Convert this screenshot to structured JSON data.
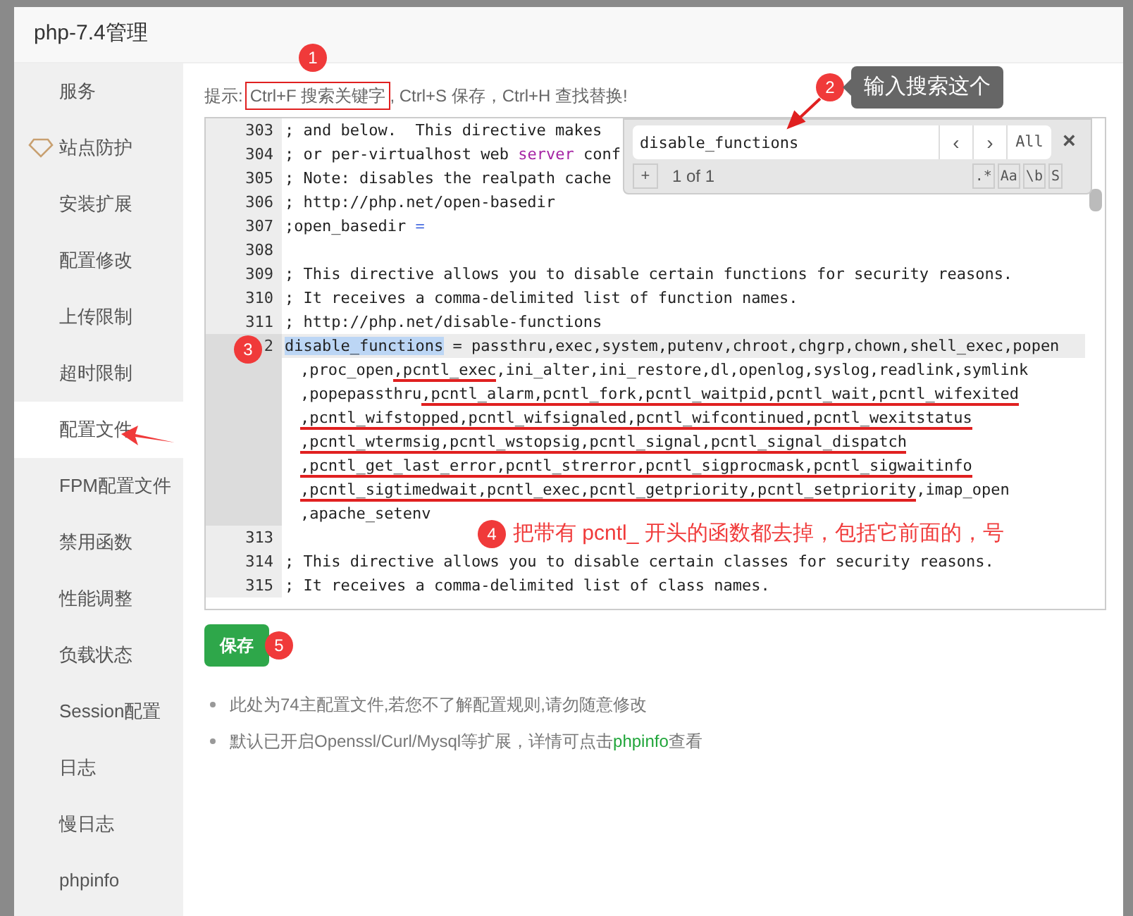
{
  "window": {
    "title": "php-7.4管理"
  },
  "sidebar": {
    "items": [
      {
        "label": "服务",
        "selected": false,
        "kind": "plain"
      },
      {
        "label": "站点防护",
        "selected": false,
        "kind": "gem"
      },
      {
        "label": "安装扩展",
        "selected": false,
        "kind": "plain"
      },
      {
        "label": "配置修改",
        "selected": false,
        "kind": "plain"
      },
      {
        "label": "上传限制",
        "selected": false,
        "kind": "plain"
      },
      {
        "label": "超时限制",
        "selected": false,
        "kind": "plain"
      },
      {
        "label": "配置文件",
        "selected": true,
        "kind": "plain"
      },
      {
        "label": "FPM配置文件",
        "selected": false,
        "kind": "plain"
      },
      {
        "label": "禁用函数",
        "selected": false,
        "kind": "plain"
      },
      {
        "label": "性能调整",
        "selected": false,
        "kind": "plain"
      },
      {
        "label": "负载状态",
        "selected": false,
        "kind": "plain"
      },
      {
        "label": "Session配置",
        "selected": false,
        "kind": "plain"
      },
      {
        "label": "日志",
        "selected": false,
        "kind": "plain"
      },
      {
        "label": "慢日志",
        "selected": false,
        "kind": "plain"
      },
      {
        "label": "phpinfo",
        "selected": false,
        "kind": "plain"
      }
    ]
  },
  "hint": {
    "label": "提示:",
    "boxed": "Ctrl+F 搜索关键字",
    "rest": ", Ctrl+S 保存，Ctrl+H 查找替换!"
  },
  "editor": {
    "lines": [
      {
        "number": "303",
        "rows": [
          [
            {
              "text": "; and below.  This directive makes"
            }
          ]
        ]
      },
      {
        "number": "304",
        "rows": [
          [
            {
              "text": "; or per-virtualhost web "
            },
            {
              "text": "server",
              "kind": "keyword"
            },
            {
              "text": " conf"
            }
          ]
        ]
      },
      {
        "number": "305",
        "rows": [
          [
            {
              "text": "; Note: disables the realpath cache"
            }
          ]
        ]
      },
      {
        "number": "306",
        "rows": [
          [
            {
              "text": "; http://php.net/open-basedir"
            }
          ]
        ]
      },
      {
        "number": "307",
        "rows": [
          [
            {
              "text": ";open_basedir "
            },
            {
              "text": "=",
              "kind": "operator"
            }
          ]
        ]
      },
      {
        "number": "308",
        "rows": [
          []
        ]
      },
      {
        "number": "309",
        "rows": [
          [
            {
              "text": "; This directive allows you to disable certain functions for security reasons."
            }
          ]
        ]
      },
      {
        "number": "310",
        "rows": [
          [
            {
              "text": "; It receives a comma-delimited list of function names."
            }
          ]
        ]
      },
      {
        "number": "311",
        "rows": [
          [
            {
              "text": "; http://php.net/disable-functions"
            }
          ]
        ]
      },
      {
        "number": "2",
        "active": true,
        "rows": [
          [
            {
              "text": "disable_functions",
              "kind": "match"
            },
            {
              "text": " = passthru,exec,system,putenv,chroot,chgrp,chown,shell_exec,popen"
            }
          ],
          [
            {
              "text": ",proc_open"
            },
            {
              "text": ",pcntl_exec",
              "underlined": true
            },
            {
              "text": ",ini_alter,ini_restore,dl,openlog,syslog,readlink,symlink"
            }
          ],
          [
            {
              "text": ",popepassthru"
            },
            {
              "text": ",pcntl_alarm,pcntl_fork,pcntl_waitpid,pcntl_wait,pcntl_wifexited",
              "underlined": true
            }
          ],
          [
            {
              "text": ",pcntl_wifstopped,pcntl_wifsignaled,pcntl_wifcontinued,pcntl_wexitstatus",
              "underlined": true
            }
          ],
          [
            {
              "text": ",pcntl_wtermsig,pcntl_wstopsig,pcntl_signal,pcntl_signal_dispatch",
              "underlined": true
            }
          ],
          [
            {
              "text": ",pcntl_get_last_error,pcntl_strerror,pcntl_sigprocmask,pcntl_sigwaitinfo",
              "underlined": true
            }
          ],
          [
            {
              "text": ",pcntl_sigtimedwait,pcntl_exec,pcntl_getpriority,pcntl_setpriority",
              "underlined": true
            },
            {
              "text": ",imap_open"
            }
          ],
          [
            {
              "text": ",apache_setenv"
            }
          ]
        ]
      },
      {
        "number": "313",
        "rows": [
          []
        ]
      },
      {
        "number": "314",
        "rows": [
          [
            {
              "text": "; This directive allows you to disable certain classes for security reasons."
            }
          ]
        ]
      },
      {
        "number": "315",
        "rows": [
          [
            {
              "text": "; It receives a comma-delimited list of class names."
            }
          ]
        ]
      }
    ]
  },
  "search": {
    "value": "disable_functions",
    "prev": "‹",
    "next": "›",
    "all": "All",
    "close": "×",
    "add": "+",
    "count": "1 of 1",
    "options": [
      ".*",
      "Aa",
      "\\b",
      "S"
    ]
  },
  "save_button": {
    "label": "保存"
  },
  "notes": [
    {
      "text": "此处为74主配置文件,若您不了解配置规则,请勿随意修改"
    },
    {
      "text": "默认已开启Openssl/Curl/Mysql等扩展，详情可点击",
      "link": "phpinfo",
      "after": "查看"
    }
  ],
  "annotations": {
    "step_1": "1",
    "step_2": "2",
    "step_2_tip": "输入搜索这个",
    "step_3": "3",
    "step_4": "4",
    "step_4_note": "把带有 pcntl_ 开头的函数都去掉，包括它前面的，号",
    "step_5": "5"
  }
}
